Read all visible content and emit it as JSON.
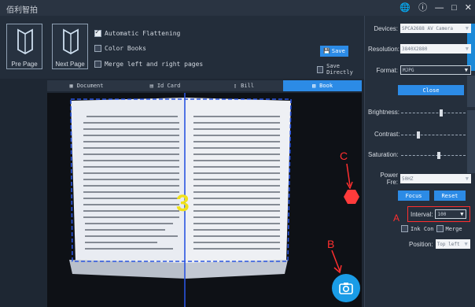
{
  "app": {
    "title": "佰利智拍"
  },
  "window": {
    "controls": [
      "globe-icon",
      "info-icon",
      "minimize-icon",
      "maximize-icon",
      "close-icon"
    ]
  },
  "toolbar": {
    "pre_page": "Pre Page",
    "next_page": "Next Page",
    "options": [
      {
        "label": "Automatic Flattening",
        "checked": true
      },
      {
        "label": "Color Books",
        "checked": false
      },
      {
        "label": "Merge left and right pages",
        "checked": false
      }
    ],
    "save_label": "Save",
    "save_directly_label": "Save Directly"
  },
  "modes": [
    {
      "label": "Document",
      "icon": "document-icon",
      "active": false
    },
    {
      "label": "Id Card",
      "icon": "idcard-icon",
      "active": false
    },
    {
      "label": "Bill",
      "icon": "bill-icon",
      "active": false
    },
    {
      "label": "Book",
      "icon": "book-icon",
      "active": true
    }
  ],
  "preview": {
    "page_number_overlay": "3"
  },
  "panel": {
    "devices_label": "Devices:",
    "devices_value": "SPCA2688 AV Camera",
    "resolution_label": "Resolution:",
    "resolution_value": "3840X2880",
    "format_label": "Format:",
    "format_value": "MJPG",
    "close_label": "Close",
    "brightness_label": "Brightness:",
    "brightness_level": 0.62,
    "contrast_label": "Contrast:",
    "contrast_level": 0.27,
    "saturation_label": "Saturation:",
    "saturation_level": 0.58,
    "power_label": "Power Fre:",
    "power_value": "50HZ",
    "focus_label": "Focus",
    "reset_label": "Reset",
    "interval_label": "Interval:",
    "interval_value": "100",
    "ink_label": "Ink Con",
    "merge_label": "Merge",
    "position_label": "Position:",
    "position_value": "Top left"
  },
  "annotations": {
    "a": "A",
    "b": "B",
    "c": "C"
  },
  "colors": {
    "accent": "#2c8be6",
    "marker": "#ff2f2f",
    "camera": "#1a9ce6"
  }
}
